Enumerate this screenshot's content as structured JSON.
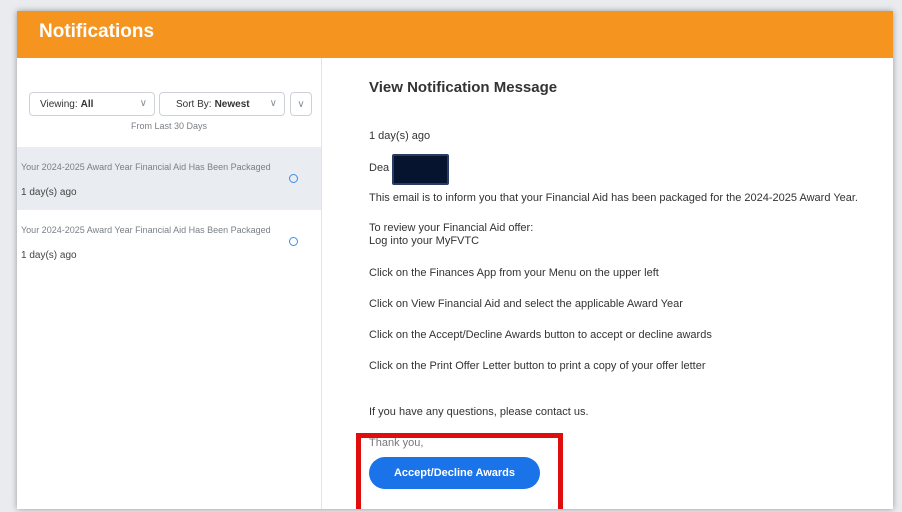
{
  "header": {
    "title": "Notifications"
  },
  "filters": {
    "viewing_label": "Viewing:",
    "viewing_value": "All",
    "sort_label": "Sort By:",
    "sort_value": "Newest",
    "range_text": "From Last 30 Days"
  },
  "notifications": [
    {
      "subject": "Your 2024-2025 Award Year Financial Aid Has Been Packaged",
      "age": "1 day(s) ago",
      "selected": true
    },
    {
      "subject": "Your 2024-2025 Award Year Financial Aid Has Been Packaged",
      "age": "1 day(s) ago",
      "selected": false
    }
  ],
  "message": {
    "title": "View Notification Message",
    "age": "1 day(s) ago",
    "greeting": "Dea",
    "lines": [
      "This email is to inform you that your Financial Aid has been packaged for the 2024-2025 Award Year.",
      "To review your Financial Aid offer:",
      "Log into your MyFVTC",
      "Click on the Finances App from your Menu on the upper left",
      "Click on View Financial Aid and select the applicable Award Year",
      "Click on the Accept/Decline Awards button to accept or decline awards",
      "Click on the Print Offer Letter button to print a copy of your offer letter",
      "If you have any questions, please contact us.",
      "Thank you,"
    ],
    "button_label": "Accept/Decline Awards"
  },
  "colors": {
    "header": "#f5941f",
    "accent": "#1a73e8",
    "highlight": "#e00d0d"
  }
}
